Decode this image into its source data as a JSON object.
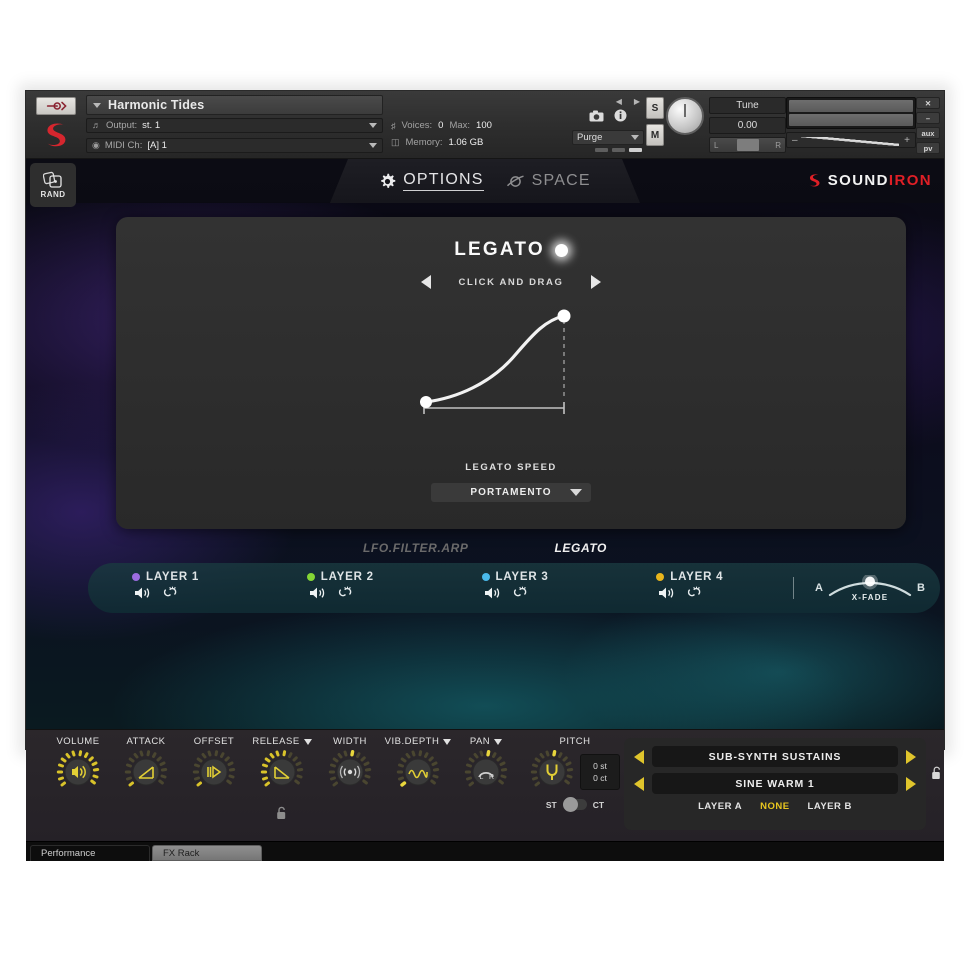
{
  "kontakt": {
    "instrument_name": "Harmonic Tides",
    "output_label": "Output:",
    "output_value": "st. 1",
    "midi_label": "MIDI Ch:",
    "midi_value": "[A]  1",
    "voices_label": "Voices:",
    "voices_value": "0",
    "max_label": "Max:",
    "max_value": "100",
    "memory_label": "Memory:",
    "memory_value": "1.06 GB",
    "purge_label": "Purge",
    "solo_label": "S",
    "mute_label": "M",
    "tune_label": "Tune",
    "tune_value": "0.00",
    "pan_left": "L",
    "pan_right": "R",
    "vol_minus": "–",
    "vol_plus": "+",
    "right_buttons": [
      "✕",
      "–",
      "aux",
      "pv"
    ]
  },
  "topbar": {
    "rand_label": "RAND",
    "tabs": [
      {
        "label": "OPTIONS",
        "icon": "gear-icon",
        "active": true
      },
      {
        "label": "SPACE",
        "icon": "space-icon",
        "active": false
      }
    ],
    "brand_white": "SOUND",
    "brand_red": "IRON",
    "brand_accent": "#e01f26"
  },
  "legato_panel": {
    "title": "LEGATO",
    "drag_hint": "CLICK AND DRAG",
    "speed_label": "LEGATO SPEED",
    "mode_value": "PORTAMENTO"
  },
  "subtabs": [
    {
      "label": "LFO.FILTER.ARP",
      "active": false
    },
    {
      "label": "LEGATO",
      "active": true
    }
  ],
  "layers": [
    {
      "name": "LAYER 1",
      "color": "#9b6ce0"
    },
    {
      "name": "LAYER 2",
      "color": "#84d635"
    },
    {
      "name": "LAYER 3",
      "color": "#4ab9ea"
    },
    {
      "name": "LAYER 4",
      "color": "#e8b51c"
    }
  ],
  "xfade": {
    "a": "A",
    "b": "B",
    "label": "X-FADE"
  },
  "knobs": [
    {
      "label": "VOLUME",
      "icon": "speaker-icon",
      "has_caret": false,
      "value_pct": 72
    },
    {
      "label": "ATTACK",
      "icon": "ramp-up-icon",
      "has_caret": false,
      "value_pct": 4
    },
    {
      "label": "OFFSET",
      "icon": "offset-icon",
      "has_caret": false,
      "value_pct": 3
    },
    {
      "label": "RELEASE",
      "icon": "ramp-down-icon",
      "has_caret": true,
      "value_pct": 55
    },
    {
      "label": "WIDTH",
      "icon": "width-icon",
      "has_caret": false,
      "value_pct": 50
    },
    {
      "label": "VIB.DEPTH",
      "icon": "sine-icon",
      "has_caret": true,
      "value_pct": 8
    },
    {
      "label": "PAN",
      "icon": "pan-icon",
      "has_caret": true,
      "value_pct": 50
    }
  ],
  "pitch": {
    "label": "PITCH",
    "icon": "tuning-fork-icon",
    "semitones": "0 st",
    "cents": "0 ct",
    "st_label": "ST",
    "ct_label": "CT"
  },
  "presets": {
    "slot_a": "SUB-SYNTH SUSTAINS",
    "slot_b": "SINE WARM 1",
    "layer_a_label": "LAYER A",
    "none_label": "NONE",
    "layer_b_label": "LAYER B",
    "accent": "#e8c61f"
  },
  "footer_tabs": [
    {
      "label": "Performance",
      "active": true
    },
    {
      "label": "FX Rack",
      "active": false
    }
  ]
}
